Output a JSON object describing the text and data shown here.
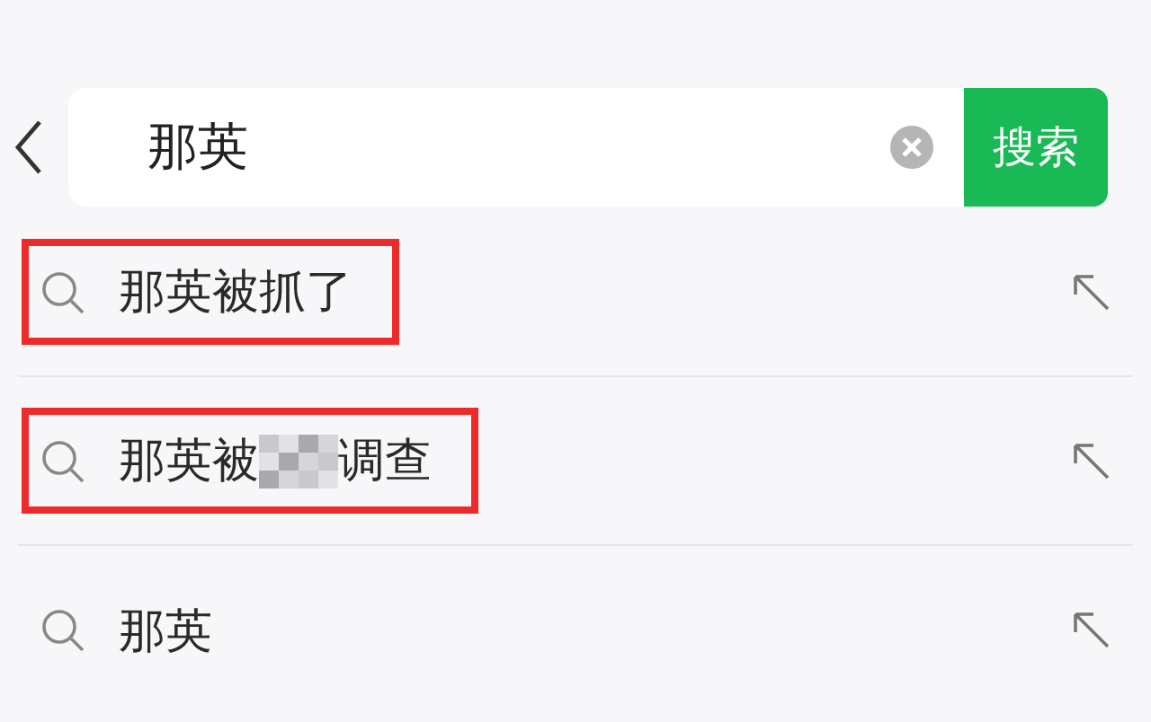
{
  "search": {
    "value": "那英",
    "button": "搜索"
  },
  "suggestions": [
    {
      "kind": "text",
      "text": "那英被抓了",
      "highlighted": true
    },
    {
      "kind": "redacted",
      "text_before": "那英被",
      "text_after": "调查",
      "highlighted": true
    },
    {
      "kind": "text",
      "text": "那英",
      "highlighted": false
    }
  ]
}
